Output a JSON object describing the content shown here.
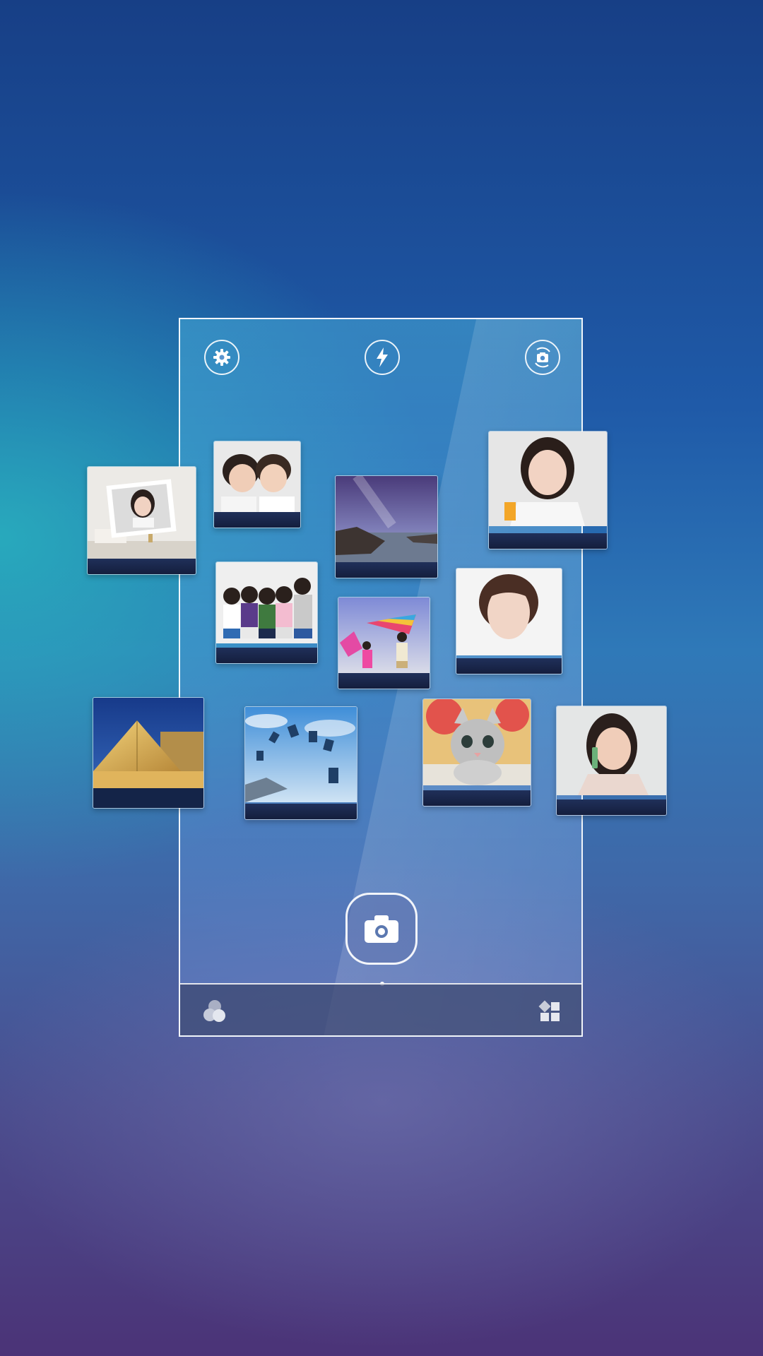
{
  "screen": {
    "background_colors": [
      "#173f86",
      "#2f79b8",
      "#4b3377"
    ]
  },
  "phone_frame": {
    "top_icons": [
      "gear-icon",
      "flash-icon",
      "camera-switch-icon"
    ],
    "shutter_icon": "camera-icon",
    "bottom_bar": {
      "left_icon": "filter-circles-icon",
      "right_icon": "grid-modes-icon"
    }
  },
  "thumbnails": [
    {
      "name": "woman-photo-frame-thumbnail"
    },
    {
      "name": "two-kids-thumbnail"
    },
    {
      "name": "night-sky-coast-thumbnail"
    },
    {
      "name": "woman-smiling-juice-thumbnail"
    },
    {
      "name": "children-group-thumbnail"
    },
    {
      "name": "kite-kids-thumbnail"
    },
    {
      "name": "woman-portrait-thumbnail"
    },
    {
      "name": "louvre-pyramid-thumbnail"
    },
    {
      "name": "skiers-jumping-thumbnail"
    },
    {
      "name": "kitten-thumbnail"
    },
    {
      "name": "girl-phone-thumbnail"
    }
  ]
}
